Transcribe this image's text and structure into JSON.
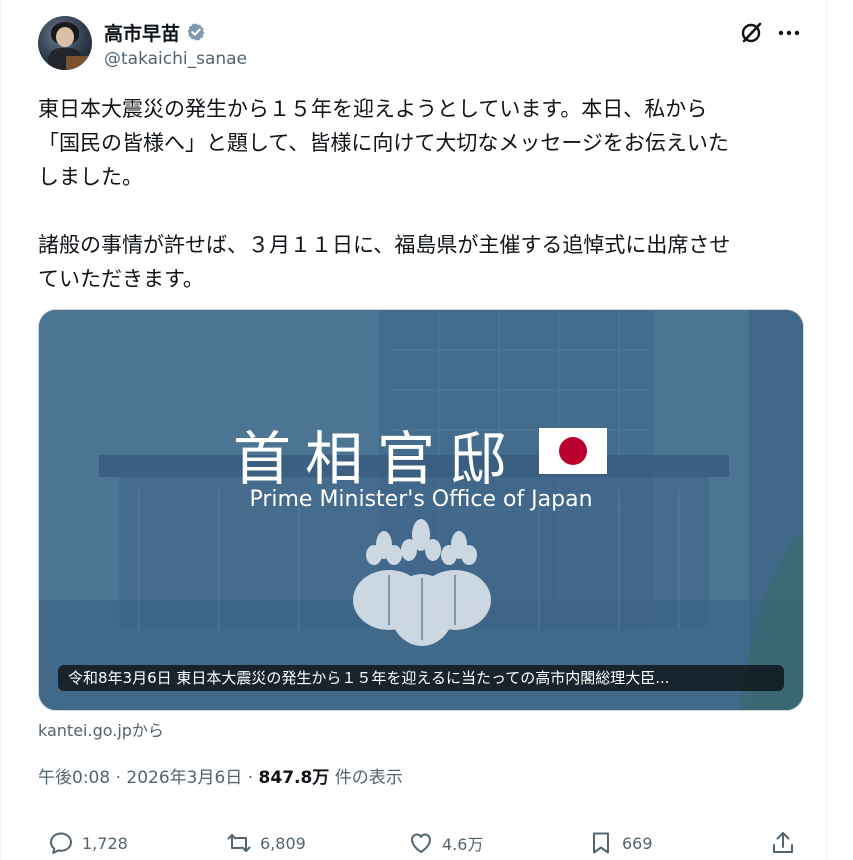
{
  "author": {
    "display_name": "高市早苗",
    "handle": "@takaichi_sanae"
  },
  "post": {
    "paragraphs": [
      [
        "東日本大震災の発生から１５年を迎えようとしています。本日、私から",
        "「国民の皆様へ」と題して、皆様に向けて大切なメッセージをお伝えいた",
        "しました。"
      ],
      [
        "諸般の事情が許せば、３月１１日に、福島県が主催する追悼式に出席させ",
        "ていただきます。"
      ]
    ]
  },
  "card": {
    "logo_kanji": "首相官邸",
    "logo_english": "Prime Minister's Office of Japan",
    "title": "令和8年3月6日 東日本大震災の発生から１５年を迎えるに当たっての高市内閣総理大臣...",
    "source": "kantei.go.jpから"
  },
  "meta": {
    "time": "午後0:08",
    "date": "2026年3月6日",
    "sep": "·",
    "views_count": "847.8万",
    "views_label": "件の表示"
  },
  "actions": {
    "replies": "1,728",
    "reposts": "6,809",
    "likes": "4.6万",
    "bookmarks": "669"
  },
  "colors": {
    "text": "#0f1419",
    "secondary": "#536471",
    "verified": "#829aab",
    "card_blue": "#47708f",
    "flag_red": "#bc002d"
  },
  "icons": [
    "verified-icon",
    "grok-icon",
    "more-icon",
    "reply-icon",
    "repost-icon",
    "like-icon",
    "bookmark-icon",
    "share-icon"
  ]
}
